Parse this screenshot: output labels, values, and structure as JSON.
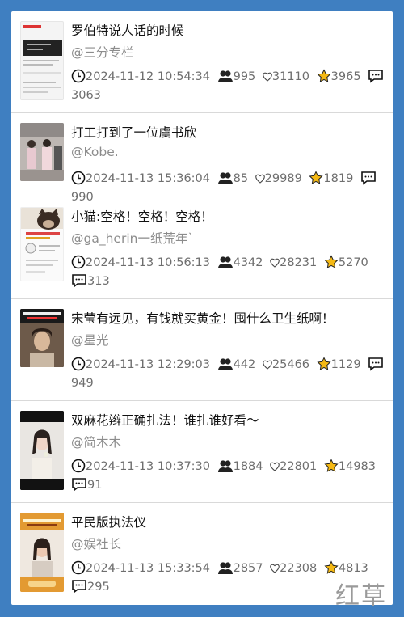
{
  "posts": [
    {
      "title": "罗伯特说人话的时候",
      "author": "@三分专栏",
      "date": "2024-11-12 10:54:34",
      "shares": "995",
      "likes": "31110",
      "favs": "3965",
      "comments": "3063"
    },
    {
      "title": "打工打到了一位虞书欣",
      "author": "@Kobe.",
      "date": "2024-11-13 15:36:04",
      "shares": "85",
      "likes": "29989",
      "favs": "1819",
      "comments": "990"
    },
    {
      "title": "小猫:空格！空格！空格！",
      "author": "@ga_herin一纸荒年`",
      "date": "2024-11-13 10:56:13",
      "shares": "4342",
      "likes": "28231",
      "favs": "5270",
      "comments": "313"
    },
    {
      "title": "宋莹有远见，有钱就买黄金！囤什么卫生纸啊！",
      "author": "@星光",
      "date": "2024-11-13 12:29:03",
      "shares": "442",
      "likes": "25466",
      "favs": "1129",
      "comments": "949"
    },
    {
      "title": "双麻花辫正确扎法！谁扎谁好看～",
      "author": "@简木木",
      "date": "2024-11-13 10:37:30",
      "shares": "1884",
      "likes": "22801",
      "favs": "14983",
      "comments": "91"
    },
    {
      "title": "平民版执法仪",
      "author": "@娱社长",
      "date": "2024-11-13 15:33:54",
      "shares": "2857",
      "likes": "22308",
      "favs": "4813",
      "comments": "295"
    }
  ],
  "watermark": "红草",
  "colors": {
    "background": "#3f7fc1",
    "star": "#f5b914",
    "author": "#8c8c8c"
  }
}
